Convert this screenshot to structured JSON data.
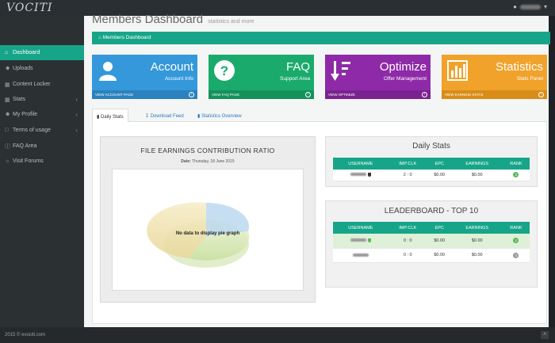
{
  "app": {
    "logo": "VOCITI"
  },
  "topbar": {
    "user_caret": "▾"
  },
  "sidebar": {
    "items": [
      {
        "label": "Dashboard",
        "active": true,
        "chevron": false
      },
      {
        "label": "Uploads",
        "chevron": false
      },
      {
        "label": "Content Locker",
        "chevron": false
      },
      {
        "label": "Stats",
        "chevron": true
      },
      {
        "label": "My Profile",
        "chevron": true
      },
      {
        "label": "Terms of usage",
        "chevron": true
      },
      {
        "label": "FAQ Area",
        "chevron": false
      },
      {
        "label": "Visit Forums",
        "chevron": false
      }
    ]
  },
  "footer": {
    "copyright": "2015 © evociti.com"
  },
  "page": {
    "title": "Members Dashboard",
    "subtitle": "statistics and more",
    "breadcrumb": "Members Dashboard"
  },
  "cards": [
    {
      "title": "Account",
      "subtitle": "Account Info",
      "footer": "VIEW ACCOUNT PAGE",
      "color": "#3498db",
      "icon": "user-icon"
    },
    {
      "title": "FAQ",
      "subtitle": "Support Area",
      "footer": "VIEW FAQ PAGE",
      "color": "#1aab6c",
      "icon": "question-icon"
    },
    {
      "title": "Optimize",
      "subtitle": "Offer Management",
      "footer": "VIEW OPTIMIZE",
      "color": "#8e2aa8",
      "icon": "sort-icon"
    },
    {
      "title": "Statistics",
      "subtitle": "Stats Panel",
      "footer": "VIEW EARNING STATS",
      "color": "#f0a22a",
      "icon": "bar-chart-icon"
    }
  ],
  "tabs": [
    {
      "label": "Daily Stats",
      "active": true
    },
    {
      "label": "Download Feed"
    },
    {
      "label": "Statistics Overview"
    }
  ],
  "pie_panel": {
    "title": "FILE EARNINGS CONTRIBUTION RATIO",
    "date_label": "Date:",
    "date_value": "Thursday, 18 June 2015",
    "message": "No data to display pie graph"
  },
  "daily_stats": {
    "title": "Daily Stats",
    "headers": [
      "USERNAME",
      "IMP:CLK",
      "EPC",
      "EARNINGS",
      "RANK"
    ],
    "rows": [
      {
        "imp_clk": "2 : 0",
        "epc": "$0.00",
        "earnings": "$0.00",
        "rank": "1",
        "rank_color": "#5cb85c"
      }
    ]
  },
  "leaderboard": {
    "title": "LEADERBOARD - TOP 10",
    "headers": [
      "USERNAME",
      "IMP:CLK",
      "EPC",
      "EARNINGS",
      "RANK"
    ],
    "rows": [
      {
        "imp_clk": "0 : 0",
        "epc": "$0.00",
        "earnings": "$0.00",
        "rank": "1",
        "rank_color": "#5cb85c",
        "highlight": true
      },
      {
        "imp_clk": "0 : 0",
        "epc": "$0.00",
        "earnings": "$0.00",
        "rank": "2",
        "rank_color": "#999999"
      }
    ]
  }
}
